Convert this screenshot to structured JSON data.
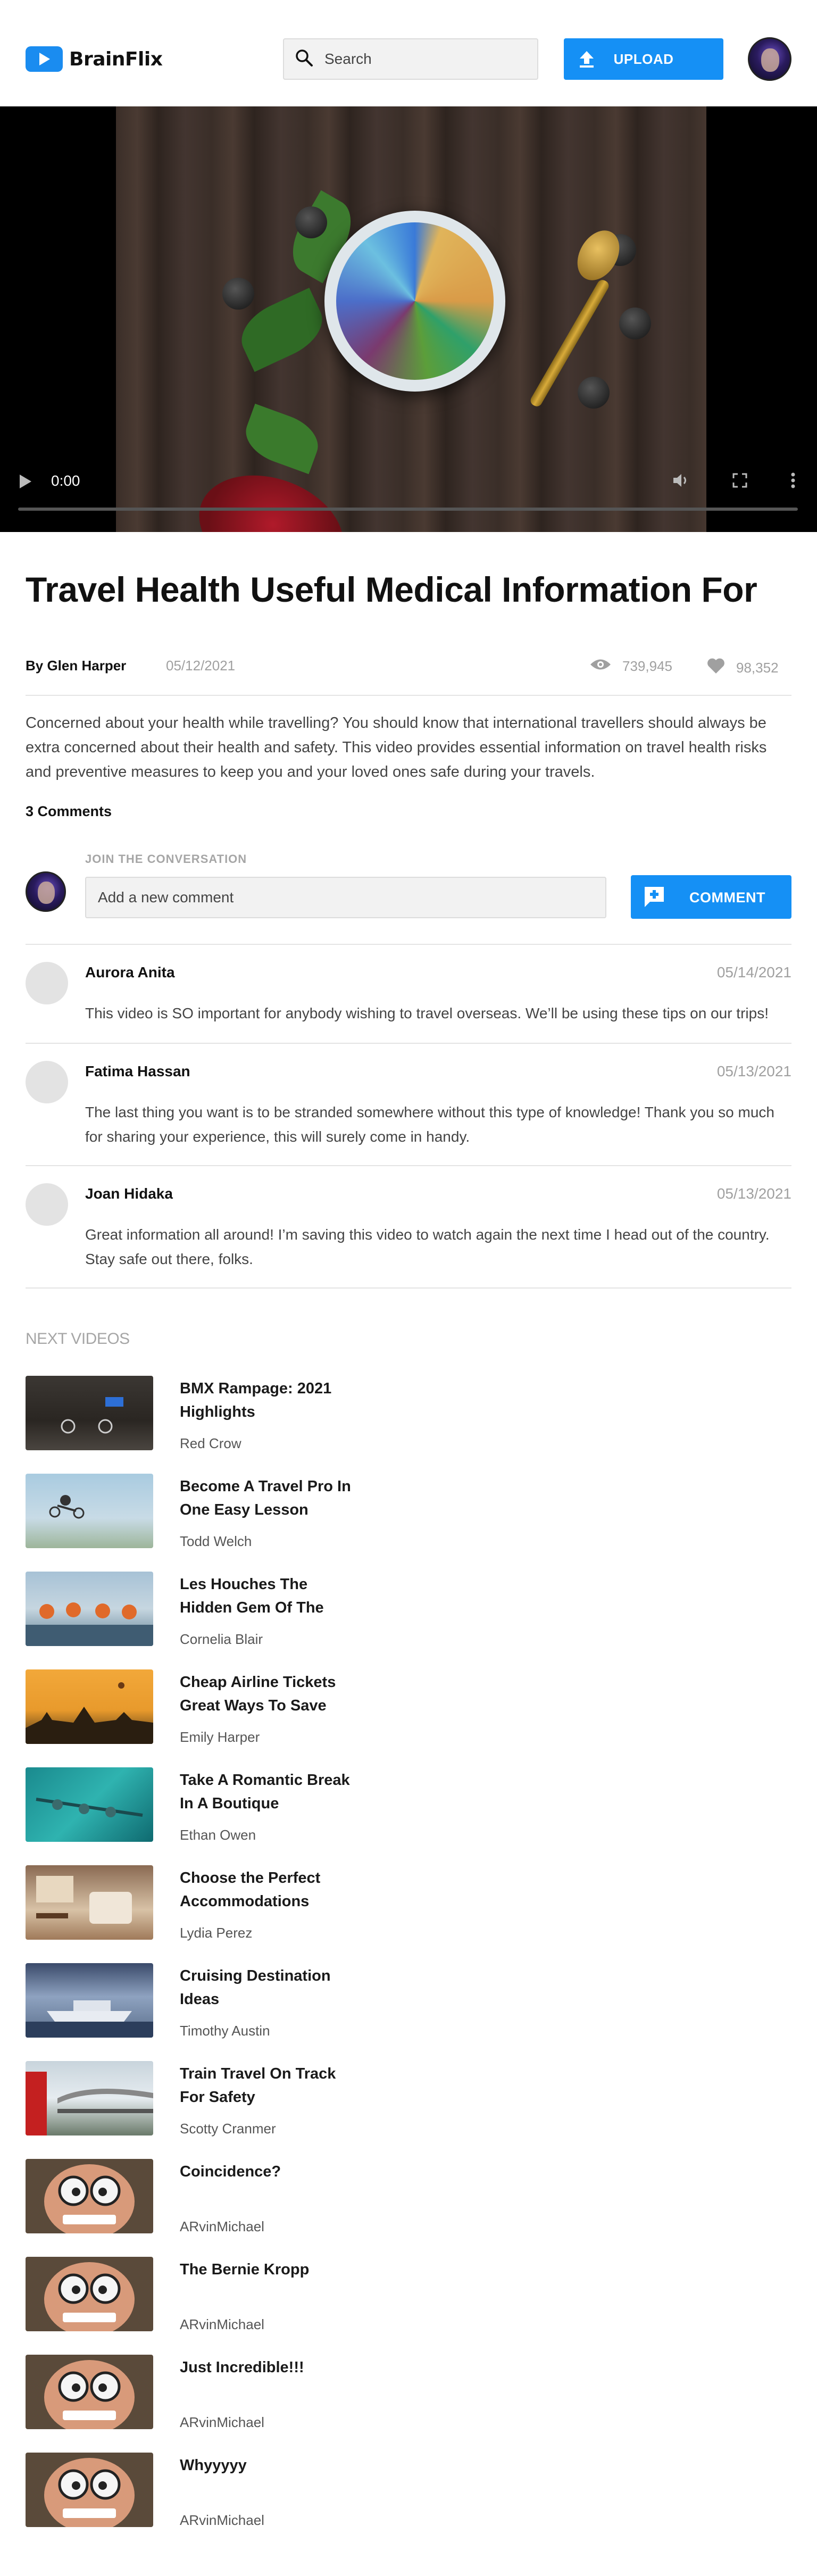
{
  "header": {
    "brand": "BrainFlix",
    "search_placeholder": "Search",
    "upload_label": "UPLOAD"
  },
  "video": {
    "time": "0:00",
    "progress": 0
  },
  "main": {
    "title": "Travel Health Useful Medical Information For",
    "author": "By Glen Harper",
    "date": "05/12/2021",
    "views": "739,945",
    "likes": "98,352",
    "description": "Concerned about your health while travelling? You should know that international travellers should always be extra concerned about their health and safety. This video provides essential information on travel health risks and preventive measures to keep you and your loved ones safe during your travels.",
    "comments_count": "3 Comments"
  },
  "comment_form": {
    "label": "JOIN THE CONVERSATION",
    "placeholder": "Add a new comment",
    "button_label": "COMMENT"
  },
  "comments": [
    {
      "name": "Aurora Anita",
      "date": "05/14/2021",
      "text": "This video is SO important for anybody wishing to travel overseas. We’ll be using these tips on our trips!"
    },
    {
      "name": "Fatima Hassan",
      "date": "05/13/2021",
      "text": "The last thing you want is to be stranded somewhere without this type of knowledge! Thank you so much for sharing your experience, this will surely come in handy."
    },
    {
      "name": "Joan Hidaka",
      "date": "05/13/2021",
      "text": "Great information all around! I’m saving this video to watch again the next time I head out of the country. Stay safe out there, folks."
    }
  ],
  "next_videos": {
    "heading": "NEXT VIDEOS",
    "items": [
      {
        "title": "BMX Rampage: 2021 Highlights",
        "channel": "Red Crow"
      },
      {
        "title": "Become A Travel Pro In One Easy Lesson",
        "channel": "Todd Welch"
      },
      {
        "title": "Les Houches The Hidden Gem Of The",
        "channel": "Cornelia Blair"
      },
      {
        "title": "Cheap Airline Tickets Great Ways To Save",
        "channel": "Emily Harper"
      },
      {
        "title": "Take A Romantic Break In A Boutique",
        "channel": "Ethan Owen"
      },
      {
        "title": "Choose the Perfect Accommodations",
        "channel": "Lydia Perez"
      },
      {
        "title": "Cruising Destination Ideas",
        "channel": "Timothy Austin"
      },
      {
        "title": "Train Travel On Track For Safety",
        "channel": "Scotty Cranmer"
      },
      {
        "title": "Coincidence?",
        "channel": "ARvinMichael"
      },
      {
        "title": "The Bernie Kropp",
        "channel": "ARvinMichael"
      },
      {
        "title": "Just Incredible!!!",
        "channel": "ARvinMichael"
      },
      {
        "title": "Whyyyyy",
        "channel": "ARvinMichael"
      }
    ]
  },
  "colors": {
    "accent": "#1590F5",
    "muted_text": "#A0A0A0",
    "divider": "#E4E4E4"
  }
}
